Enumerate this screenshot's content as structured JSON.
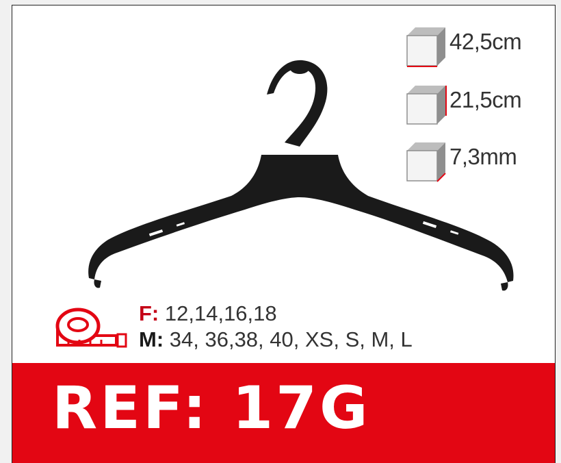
{
  "product": {
    "dimensions": [
      {
        "icon": "cube-width-icon",
        "value": "42,5cm"
      },
      {
        "icon": "cube-height-icon",
        "value": "21,5cm"
      },
      {
        "icon": "cube-depth-icon",
        "value": "7,3mm"
      }
    ],
    "sizes": {
      "female_label": "F:",
      "female_values": " 12,14,16,18",
      "male_label": "M:",
      "male_values": " 34, 36,38, 40, XS, S, M, L"
    },
    "ref_label": "REF: 17G"
  },
  "colors": {
    "accent": "#e30613",
    "text": "#333333",
    "hanger": "#1a1a1a"
  },
  "icons": [
    "hanger-illustration",
    "measuring-tape-icon",
    "cube-width-icon",
    "cube-height-icon",
    "cube-depth-icon"
  ]
}
